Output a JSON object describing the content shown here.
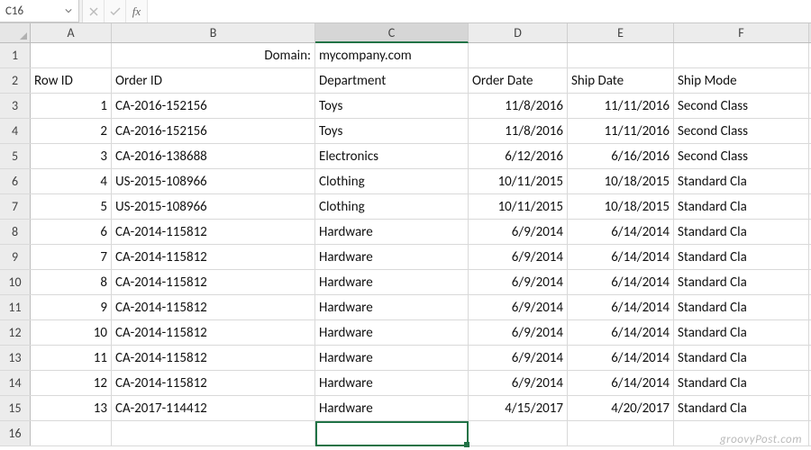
{
  "formula_bar": {
    "name_box": "C16",
    "formula_value": ""
  },
  "columns": [
    {
      "letter": "A",
      "class": "cA",
      "selected": false
    },
    {
      "letter": "B",
      "class": "cB",
      "selected": false
    },
    {
      "letter": "C",
      "class": "cC",
      "selected": true
    },
    {
      "letter": "D",
      "class": "cD",
      "selected": false
    },
    {
      "letter": "E",
      "class": "cE",
      "selected": false
    },
    {
      "letter": "F",
      "class": "cF",
      "selected": false
    }
  ],
  "row1": {
    "label_cell": "Domain:",
    "value_cell": "mycompany.com"
  },
  "headers": {
    "A": "Row ID",
    "B": "Order ID",
    "C": "Department",
    "D": "Order Date",
    "E": "Ship Date",
    "F": "Ship Mode"
  },
  "data_rows": [
    {
      "row_id": 1,
      "order_id": "CA-2016-152156",
      "department": "Toys",
      "order_date": "11/8/2016",
      "ship_date": "11/11/2016",
      "ship_mode": "Second Class"
    },
    {
      "row_id": 2,
      "order_id": "CA-2016-152156",
      "department": "Toys",
      "order_date": "11/8/2016",
      "ship_date": "11/11/2016",
      "ship_mode": "Second Class"
    },
    {
      "row_id": 3,
      "order_id": "CA-2016-138688",
      "department": "Electronics",
      "order_date": "6/12/2016",
      "ship_date": "6/16/2016",
      "ship_mode": "Second Class"
    },
    {
      "row_id": 4,
      "order_id": "US-2015-108966",
      "department": "Clothing",
      "order_date": "10/11/2015",
      "ship_date": "10/18/2015",
      "ship_mode": "Standard Cla"
    },
    {
      "row_id": 5,
      "order_id": "US-2015-108966",
      "department": "Clothing",
      "order_date": "10/11/2015",
      "ship_date": "10/18/2015",
      "ship_mode": "Standard Cla"
    },
    {
      "row_id": 6,
      "order_id": "CA-2014-115812",
      "department": "Hardware",
      "order_date": "6/9/2014",
      "ship_date": "6/14/2014",
      "ship_mode": "Standard Cla"
    },
    {
      "row_id": 7,
      "order_id": "CA-2014-115812",
      "department": "Hardware",
      "order_date": "6/9/2014",
      "ship_date": "6/14/2014",
      "ship_mode": "Standard Cla"
    },
    {
      "row_id": 8,
      "order_id": "CA-2014-115812",
      "department": "Hardware",
      "order_date": "6/9/2014",
      "ship_date": "6/14/2014",
      "ship_mode": "Standard Cla"
    },
    {
      "row_id": 9,
      "order_id": "CA-2014-115812",
      "department": "Hardware",
      "order_date": "6/9/2014",
      "ship_date": "6/14/2014",
      "ship_mode": "Standard Cla"
    },
    {
      "row_id": 10,
      "order_id": "CA-2014-115812",
      "department": "Hardware",
      "order_date": "6/9/2014",
      "ship_date": "6/14/2014",
      "ship_mode": "Standard Cla"
    },
    {
      "row_id": 11,
      "order_id": "CA-2014-115812",
      "department": "Hardware",
      "order_date": "6/9/2014",
      "ship_date": "6/14/2014",
      "ship_mode": "Standard Cla"
    },
    {
      "row_id": 12,
      "order_id": "CA-2014-115812",
      "department": "Hardware",
      "order_date": "6/9/2014",
      "ship_date": "6/14/2014",
      "ship_mode": "Standard Cla"
    },
    {
      "row_id": 13,
      "order_id": "CA-2017-114412",
      "department": "Hardware",
      "order_date": "4/15/2017",
      "ship_date": "4/20/2017",
      "ship_mode": "Standard Cla"
    }
  ],
  "selected_cell": "C16",
  "watermark": "groovyPost.com"
}
